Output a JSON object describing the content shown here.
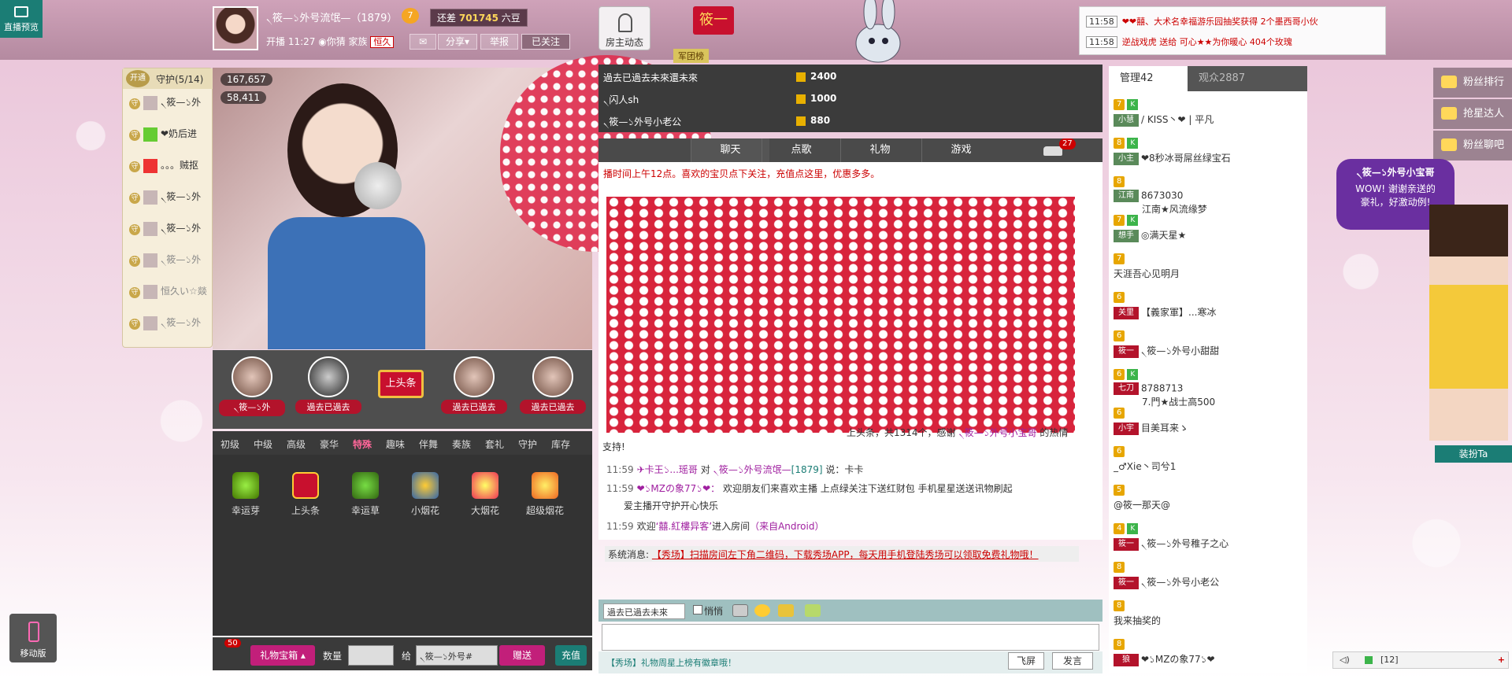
{
  "top": {
    "live_label": "直播预览",
    "host_name": "৲筱—১外号流氓—（1879）",
    "host_level": "7",
    "bean_prefix": "还差",
    "bean_value": "701745",
    "bean_suffix": "六豆",
    "start_time": "开播 11:27",
    "location": "你猜",
    "family_label": "家族",
    "family_tag": "恒久",
    "share_label": "分享",
    "report_label": "举报",
    "followed_label": "已关注",
    "room_news": "房主动态",
    "banner_tag": "筱一",
    "fan_club": "军团榜"
  },
  "ticker": [
    {
      "time": "11:58",
      "text": "❤❤囍、大术名幸福游乐园抽奖获得 2个墨西哥小伙"
    },
    {
      "time": "11:58",
      "text": "逆战戏虎 送给 可心★★为你暖心 404个玫瑰"
    }
  ],
  "guard": {
    "open_label": "开通",
    "title": "守护(5/14)",
    "members": [
      "৲筱—১外",
      "❤奶后进",
      "。。。贼抠",
      "৲筱—১外",
      "৲筱—১外",
      "৲筱—১外",
      "恒久い☆燚",
      "৲筱—১外"
    ]
  },
  "video": {
    "stat1": "167,657",
    "stat2": "58,411"
  },
  "top_fans": [
    {
      "name": "৲筱—১外"
    },
    {
      "name": "過去已過去"
    },
    {
      "name": "過去已過去"
    },
    {
      "name": "過去已過去"
    }
  ],
  "headline_sign": "上头条",
  "gift_tabs": [
    "初级",
    "中级",
    "高级",
    "豪华",
    "特殊",
    "趣味",
    "伴舞",
    "奏族",
    "套礼",
    "守护",
    "库存"
  ],
  "gifts": [
    "幸运芽",
    "上头条",
    "幸运草",
    "小烟花",
    "大烟花",
    "超级烟花"
  ],
  "gift_bar": {
    "box_label": "礼物宝箱",
    "box_count": "50",
    "qty_label": "数量",
    "to_label": "给",
    "to_value": "৲筱—১外号#",
    "send_label": "赠送",
    "recharge_label": "充值"
  },
  "rank": [
    {
      "name": "過去已過去未來還未來",
      "value": "2400"
    },
    {
      "name": "৲闪人sh",
      "value": "1000"
    },
    {
      "name": "৲筱—১外号小老公",
      "value": "880"
    }
  ],
  "chat_tabs": [
    "聊天",
    "点歌",
    "礼物",
    "游戏"
  ],
  "car_count": "27",
  "chat": {
    "notice": "播时间上午12点。喜欢的宝贝点下关注，充值点这里，优惠多多。",
    "sign_pre": "上头条，共1314个，感谢",
    "sign_user": "৲筱—১外号小宝哥",
    "sign_post": "的热情支持!",
    "msg1_time": "11:59",
    "msg1_user": "✈卡王১...瑶哥",
    "msg1_mid": "对",
    "msg1_target": "৲筱—১外号流氓—",
    "msg1_level": "[1879]",
    "msg1_text": "说：卡卡",
    "msg2_time": "11:59",
    "msg2_user": "❤১MZの象77১❤：",
    "msg2_text": "欢迎朋友们来喜欢主播     上点绿关注下送红财包     手机星星送送讯物刷起",
    "msg2_text2": "爱主播开守护开心快乐",
    "msg3_time": "11:59",
    "msg3_pre": "欢迎",
    "msg3_user": "‘囍.紅樓异客’",
    "msg3_mid": "进入房间",
    "msg3_src": "（来自Android）",
    "sys_label": "系统消息:",
    "sys_text": "【秀场】扫描房间左下角二维码，下载秀场APP，每天用手机登陆秀场可以领取免费礼物哦！"
  },
  "input": {
    "target": "過去已過去未來",
    "whisper": "悄悄",
    "promo": "【秀场】礼物周星上榜有徽章哦！",
    "fly": "飞屏",
    "send": "发言"
  },
  "users": {
    "admin_tab": "管理42",
    "audience_tab": "观众2887",
    "list": [
      {
        "lv": "7",
        "extra": "K",
        "title": "小慧",
        "name": "/ KISS丶❤ | 平凡"
      },
      {
        "lv": "8",
        "extra": "K",
        "title": "小主",
        "name": "❤8秒冰哥屌丝绿宝石"
      },
      {
        "lv": "8",
        "extra": "",
        "title": "江南",
        "name": "8673030",
        "name2": "江南★风流缘梦"
      },
      {
        "lv": "7",
        "extra": "K",
        "title": "想手",
        "name": "◎满天星★"
      },
      {
        "lv": "7",
        "extra": "",
        "title": "",
        "name": "天涯吾心见明月"
      },
      {
        "lv": "6",
        "extra": "",
        "title": "关里",
        "name": "【義家軍】...寒冰"
      },
      {
        "lv": "6",
        "extra": "",
        "title": "筱一",
        "name": "৲筱—১外号小甜甜"
      },
      {
        "lv": "6",
        "extra": "K",
        "title": "七刀",
        "name": "8788713",
        "name2": "7.門★战士高500"
      },
      {
        "lv": "6",
        "extra": "",
        "title": "小宇",
        "name": "目美耳来ゝ"
      },
      {
        "lv": "6",
        "extra": "",
        "title": "",
        "name": "_♂Xie丶司兮1"
      },
      {
        "lv": "5",
        "extra": "",
        "title": "",
        "name": "@筱一那天@"
      },
      {
        "lv": "4",
        "extra": "K",
        "title": "筱一",
        "name": "৲筱—১外号稚子之心"
      },
      {
        "lv": "8",
        "extra": "",
        "title": "筱一",
        "name": "৲筱—১外号小老公"
      },
      {
        "lv": "8",
        "extra": "",
        "title": "",
        "name": "我来抽奖的"
      },
      {
        "lv": "8",
        "extra": "",
        "title": "狼",
        "name": "❤১MZの象77১❤"
      }
    ]
  },
  "side_menu": [
    "粉丝排行",
    "抢星达人",
    "粉丝聊吧"
  ],
  "bubble": {
    "line1": "৲筱—১外号小宝哥",
    "line2": "WOW! 谢谢亲送的",
    "line3": "豪礼，好激动例!"
  },
  "dress_label": "装扮Ta",
  "mobile_label": "移动版",
  "online": "[12]",
  "colors": {
    "teal": "#1b7d75",
    "magenta": "#c21f7a",
    "red": "#c8102e"
  }
}
